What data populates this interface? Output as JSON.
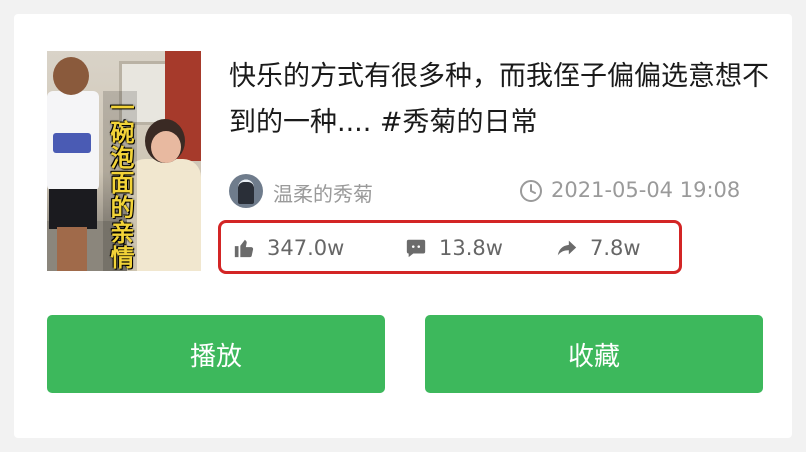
{
  "video": {
    "title": "快乐的方式有很多种，而我侄子偏偏选意想不到的一种.... #秀菊的日常",
    "thumbnail_overlay_text": "一碗泡面的亲情"
  },
  "author": {
    "name": "温柔的秀菊",
    "avatar_icon": "avatar-icon"
  },
  "published_at": "2021-05-04 19:08",
  "stats": {
    "likes": "347.0w",
    "comments": "13.8w",
    "shares": "7.8w"
  },
  "buttons": {
    "play": "播放",
    "collect": "收藏"
  },
  "colors": {
    "accent": "#3db85c",
    "highlight_border": "#d32525",
    "muted_text": "#9a9a9a"
  }
}
